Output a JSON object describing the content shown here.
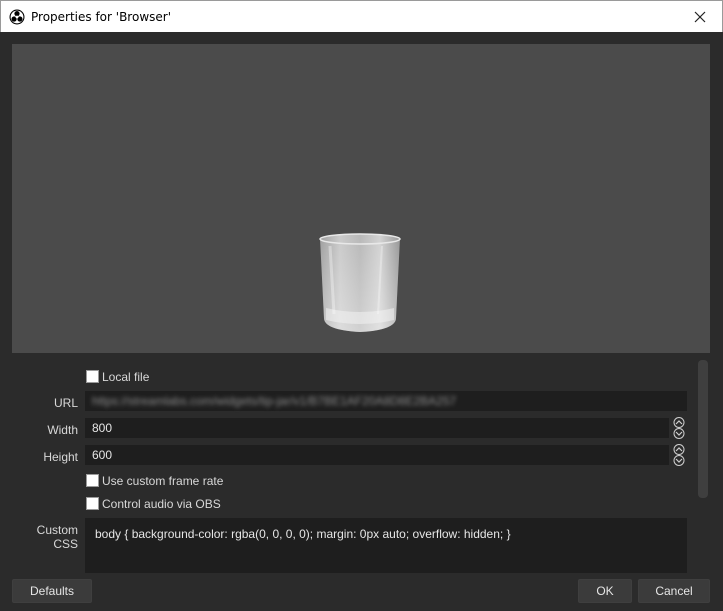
{
  "window": {
    "title": "Properties for 'Browser'",
    "icons": {
      "app": "obs-logo-icon",
      "close": "close-icon"
    }
  },
  "preview": {
    "content": "glass-image"
  },
  "form": {
    "local_file": {
      "label": "Local file",
      "checked": false
    },
    "url": {
      "label": "URL",
      "value": "https://streamlabs.com/widgets/tip-jar/v1/B7BE1AF20A8D8E2BA257"
    },
    "width": {
      "label": "Width",
      "value": "800"
    },
    "height": {
      "label": "Height",
      "value": "600"
    },
    "custom_frame_rate": {
      "label": "Use custom frame rate",
      "checked": false
    },
    "control_audio": {
      "label": "Control audio via OBS",
      "checked": false
    },
    "custom_css": {
      "label": "Custom CSS",
      "value": "body { background-color: rgba(0, 0, 0, 0); margin: 0px auto; overflow: hidden; }"
    }
  },
  "buttons": {
    "defaults": "Defaults",
    "ok": "OK",
    "cancel": "Cancel"
  },
  "colors": {
    "dialog_bg": "#2b2b2b",
    "preview_bg": "#4b4b4b",
    "field_bg": "#1e1e1e",
    "button_bg": "#3b3b3b"
  }
}
